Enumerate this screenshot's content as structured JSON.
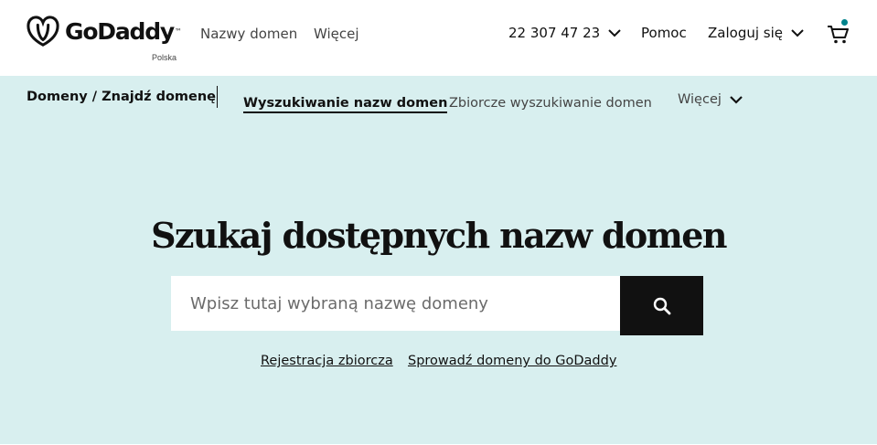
{
  "header": {
    "brand": "GoDaddy",
    "region": "Polska",
    "nav": {
      "domains": "Nazwy domen",
      "more": "Więcej"
    },
    "phone": "22 307 47 23",
    "help": "Pomoc",
    "login": "Zaloguj się",
    "cart_badge_color": "#00838c"
  },
  "subnav": {
    "breadcrumb": "Domeny / Znajdź domenę",
    "active_tab": "Wyszukiwanie nazw domen",
    "bulk_tab": "Zbiorcze wyszukiwanie domen",
    "more": "Więcej"
  },
  "hero": {
    "title": "Szukaj dostępnych nazw domen",
    "search_placeholder": "Wpisz tutaj wybraną nazwę domeny",
    "search_value": "",
    "background": "#d8efef",
    "links": {
      "bulk_registration": "Rejestracja zbiorcza",
      "transfer": "Sprowadź domeny do GoDaddy"
    }
  },
  "icons": {
    "logo": "godaddy-logo-icon",
    "chevron": "chevron-down-icon",
    "cart": "cart-icon",
    "search": "search-icon"
  }
}
